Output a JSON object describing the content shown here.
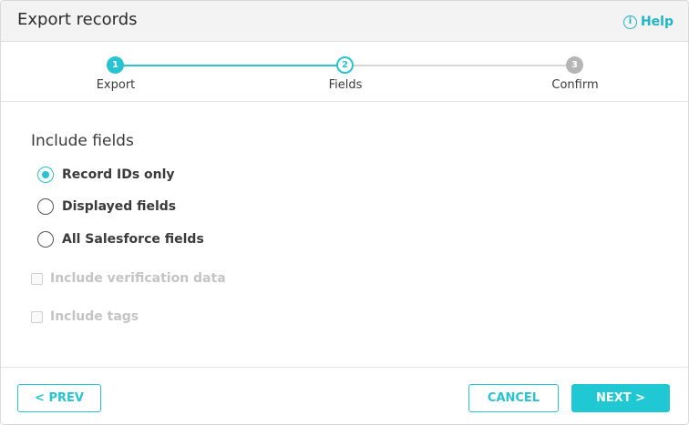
{
  "dialog": {
    "title": "Export records",
    "help_label": "Help",
    "help_icon_glyph": "i"
  },
  "stepper": {
    "steps": [
      {
        "number": "1",
        "label": "Export",
        "state": "completed"
      },
      {
        "number": "2",
        "label": "Fields",
        "state": "current"
      },
      {
        "number": "3",
        "label": "Confirm",
        "state": "upcoming"
      }
    ]
  },
  "fields": {
    "section_title": "Include fields",
    "options": [
      {
        "label": "Record IDs only",
        "checked": true
      },
      {
        "label": "Displayed fields",
        "checked": false
      },
      {
        "label": "All Salesforce fields",
        "checked": false
      }
    ],
    "checkboxes": [
      {
        "label": "Include verification data",
        "checked": false,
        "disabled": true
      },
      {
        "label": "Include tags",
        "checked": false,
        "disabled": true
      }
    ]
  },
  "footer": {
    "prev_label": "< PREV",
    "cancel_label": "CANCEL",
    "next_label": "NEXT >"
  },
  "colors": {
    "accent": "#27c3d1",
    "disabled_text": "#c4c4c4",
    "header_bg": "#f3f3f3"
  }
}
